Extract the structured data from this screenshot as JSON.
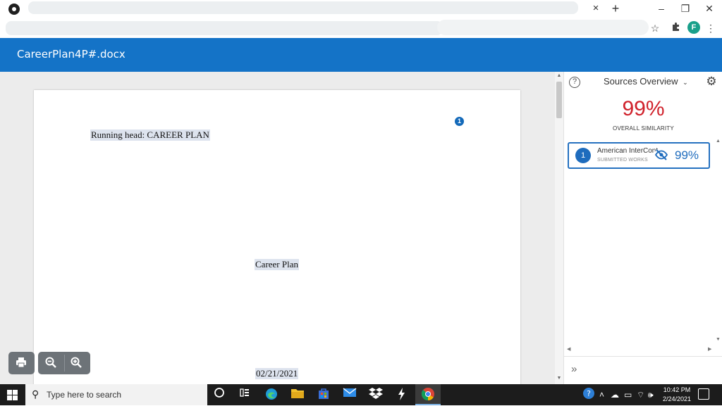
{
  "browser": {
    "window_controls": {
      "minimize": "–",
      "restore": "❐",
      "close": "✕"
    },
    "tab_close": "×",
    "new_tab": "+",
    "profile_initial": "F"
  },
  "app": {
    "file_name": "CareerPlan4P#.docx"
  },
  "document": {
    "running_head": "Running head: CAREER PLAN",
    "title": "Career Plan",
    "date": "02/21/2021",
    "match_marker": "1"
  },
  "panel": {
    "title": "Sources Overview",
    "overall_percent": "99%",
    "overall_label": "OVERALL SIMILARITY",
    "sources": [
      {
        "number": "1",
        "name": "American InterCont",
        "type": "SUBMITTED WORKS",
        "percent": "99%"
      }
    ],
    "expand": "»"
  },
  "taskbar": {
    "search_placeholder": "Type here to search",
    "time": "10:42 PM",
    "date": "2/24/2021"
  },
  "colors": {
    "header_blue": "#1473c7",
    "similarity_red": "#d0212b",
    "source_blue": "#1e6cbd"
  }
}
